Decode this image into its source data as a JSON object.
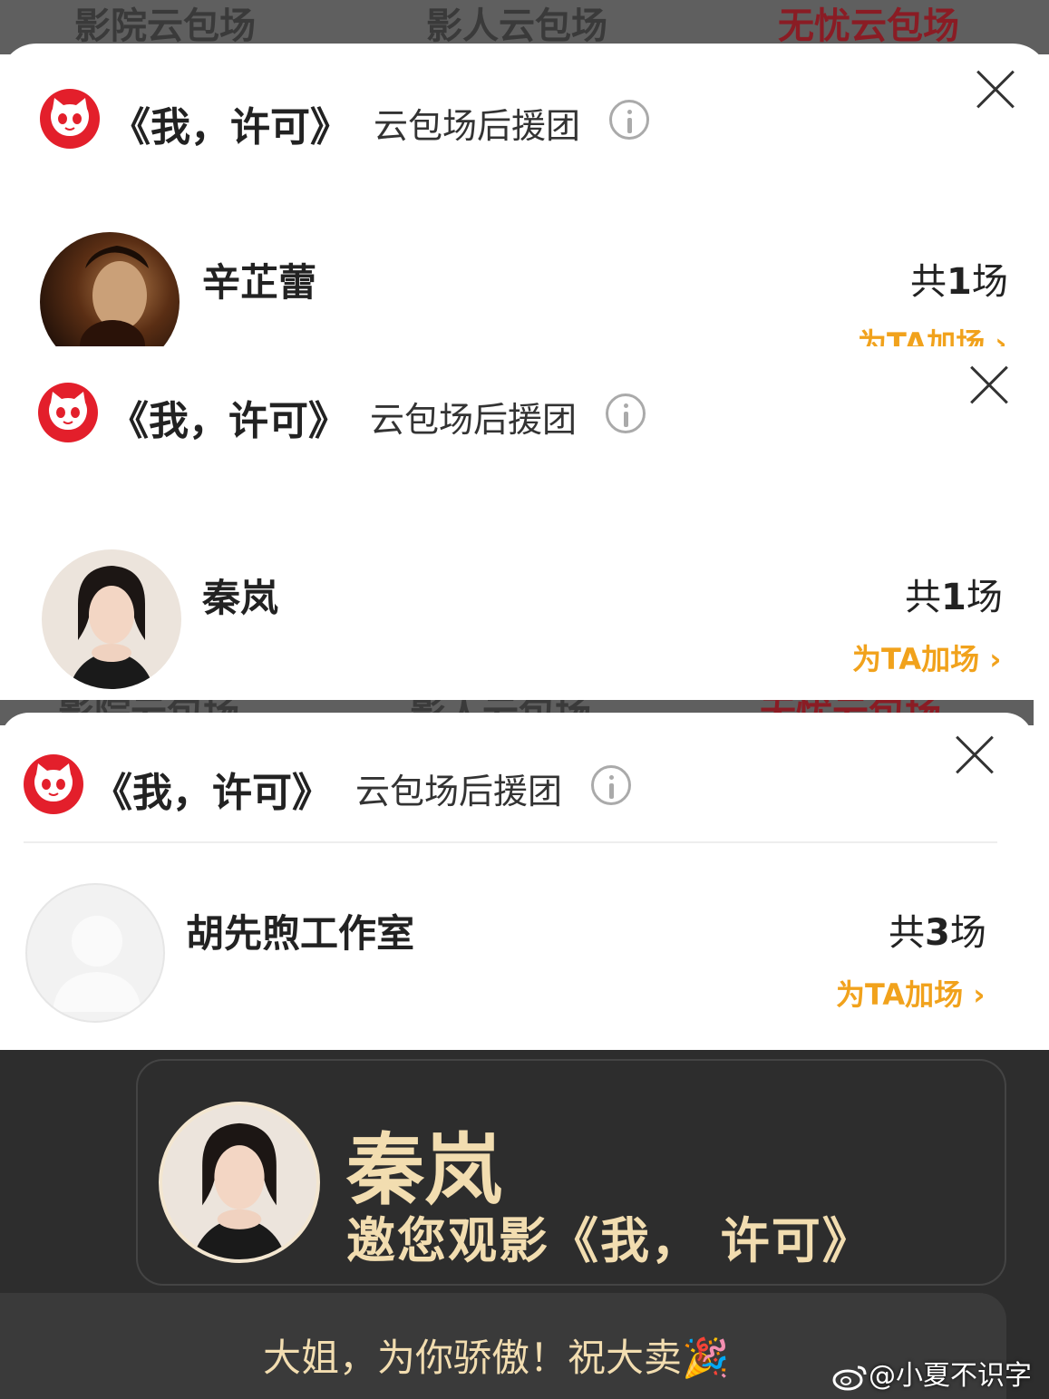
{
  "top_tabs": [
    "影院云包场",
    "影人云包场",
    "无忧云包场"
  ],
  "cards": [
    {
      "title": "《我，许可》",
      "subtitle": "云包场后援团",
      "member": {
        "name": "辛芷蕾",
        "count_prefix": "共",
        "count_num": "1",
        "count_suffix": "场",
        "action": "为TA加场 ›"
      }
    },
    {
      "title": "《我，许可》",
      "subtitle": "云包场后援团",
      "member": {
        "name": "秦岚",
        "count_prefix": "共",
        "count_num": "1",
        "count_suffix": "场",
        "action": "为TA加场 ›"
      }
    },
    {
      "title": "《我，许可》",
      "subtitle": "云包场后援团",
      "member": {
        "name": "胡先煦工作室",
        "count_prefix": "共",
        "count_num": "3",
        "count_suffix": "场",
        "action": "为TA加场 ›"
      }
    }
  ],
  "invite_card": {
    "name": "秦岚",
    "invite_text": "邀您观影《我， 许可》",
    "message": "大姐，为你骄傲！祝大卖🎉"
  },
  "watermark": "@小夏不识字",
  "colors": {
    "brand_red": "#e31f2b",
    "action_orange": "#f1a21c",
    "gold": "#f2ddb0"
  }
}
